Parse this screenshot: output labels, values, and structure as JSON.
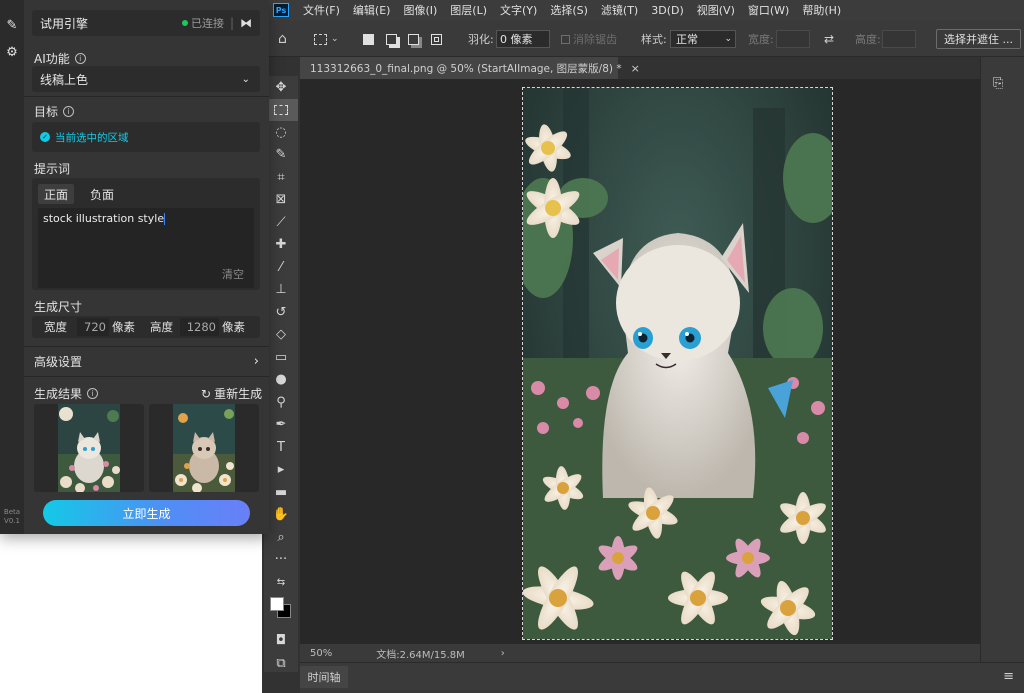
{
  "photoshop": {
    "logo": "Ps",
    "menu": [
      "文件(F)",
      "编辑(E)",
      "图像(I)",
      "图层(L)",
      "文字(Y)",
      "选择(S)",
      "滤镜(T)",
      "3D(D)",
      "视图(V)",
      "窗口(W)",
      "帮助(H)"
    ],
    "options": {
      "feather_label": "羽化:",
      "feather_value": "0 像素",
      "antialias_label": "消除锯齿",
      "style_label": "样式:",
      "style_value": "正常",
      "width_label": "宽度:",
      "height_label": "高度:",
      "select_mask": "选择并遮住 ..."
    },
    "doc_tab": "113312663_0_final.png @ 50% (StartAIImage, 图层蒙版/8) *",
    "status": {
      "zoom": "50%",
      "doc_info": "文档:2.64M/15.8M"
    },
    "timeline_label": "时间轴"
  },
  "plugin": {
    "beta": [
      "Beta",
      "V0.1"
    ],
    "engine": {
      "name": "试用引擎",
      "status": "已连接",
      "status_color": "#1ec95b"
    },
    "ai_function": {
      "label": "AI功能",
      "value": "线稿上色"
    },
    "target": {
      "label": "目标",
      "value": "当前选中的区域"
    },
    "prompt": {
      "label": "提示词",
      "tab_positive": "正面",
      "tab_negative": "负面",
      "text": "stock illustration style",
      "clear": "清空"
    },
    "size": {
      "label": "生成尺寸",
      "width_label": "宽度",
      "width_value": "720",
      "height_label": "高度",
      "height_value": "1280",
      "unit": "像素"
    },
    "advanced": "高级设置",
    "results": {
      "label": "生成结果",
      "regenerate": "重新生成"
    },
    "generate_button": "立即生成",
    "accent_color": "#14c9e6"
  }
}
